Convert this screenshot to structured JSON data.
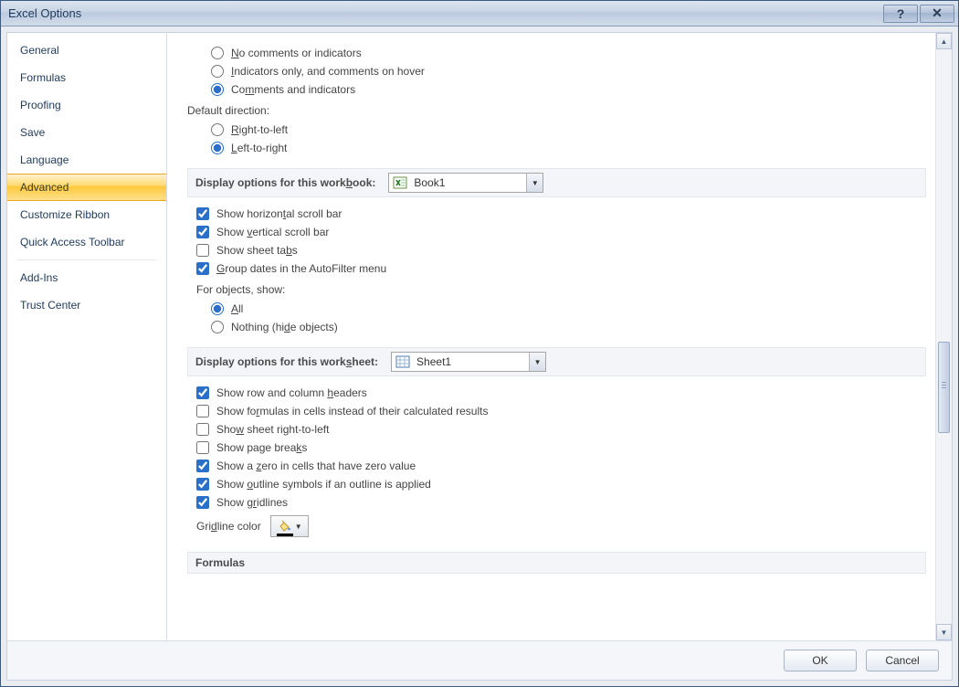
{
  "window": {
    "title": "Excel Options"
  },
  "sidebar": {
    "items": [
      {
        "label": "General"
      },
      {
        "label": "Formulas"
      },
      {
        "label": "Proofing"
      },
      {
        "label": "Save"
      },
      {
        "label": "Language"
      },
      {
        "label": "Advanced"
      },
      {
        "label": "Customize Ribbon"
      },
      {
        "label": "Quick Access Toolbar"
      },
      {
        "label": "Add-Ins"
      },
      {
        "label": "Trust Center"
      }
    ],
    "selected": "Advanced"
  },
  "comments": {
    "none": "No comments or indicators",
    "indicators": "Indicators only, and comments on hover",
    "both": "Comments and indicators"
  },
  "direction": {
    "label": "Default direction:",
    "rtl": "Right-to-left",
    "ltr": "Left-to-right"
  },
  "workbook": {
    "section": "Display options for this workbook:",
    "value": "Book1",
    "hscroll": "Show horizontal scroll bar",
    "vscroll": "Show vertical scroll bar",
    "tabs": "Show sheet tabs",
    "groupdates": "Group dates in the AutoFilter menu",
    "objects_label": "For objects, show:",
    "all": "All",
    "nothing": "Nothing (hide objects)"
  },
  "worksheet": {
    "section": "Display options for this worksheet:",
    "value": "Sheet1",
    "headers": "Show row and column headers",
    "formulas": "Show formulas in cells instead of their calculated results",
    "rtl": "Show sheet right-to-left",
    "pagebreaks": "Show page breaks",
    "zeros": "Show a zero in cells that have zero value",
    "outline": "Show outline symbols if an outline is applied",
    "gridlines": "Show gridlines",
    "gridline_color": "Gridline color"
  },
  "formulas_section": "Formulas",
  "buttons": {
    "ok": "OK",
    "cancel": "Cancel"
  }
}
